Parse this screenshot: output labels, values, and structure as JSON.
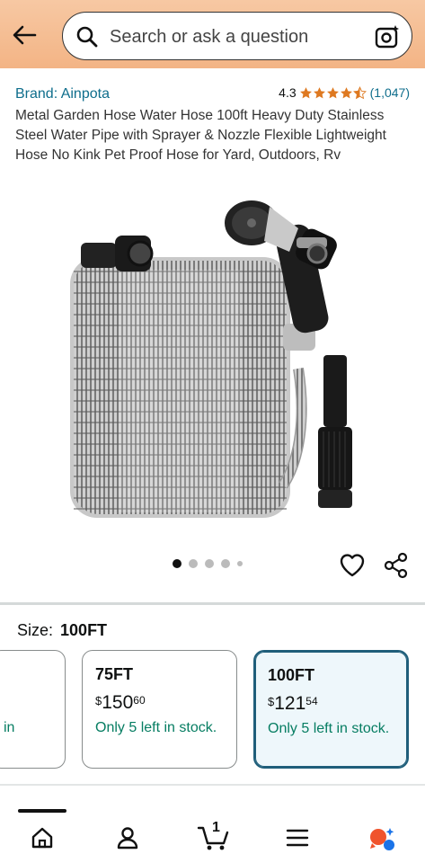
{
  "header": {
    "search_placeholder": "Search or ask a question"
  },
  "product": {
    "brand": "Brand: Ainpota",
    "rating": "4.3",
    "rating_stars": 4.3,
    "rating_count": "(1,047)",
    "title": "Metal Garden Hose Water Hose 100ft Heavy Duty Stainless Steel Water Pipe with Sprayer & Nozzle Flexible Lightweight Hose No Kink Pet Proof Hose for Yard, Outdoors, Rv",
    "image_count": 5,
    "active_image": 1
  },
  "size": {
    "label": "Size:",
    "selected": "100FT",
    "options": [
      {
        "name": "",
        "currency": "",
        "whole": "",
        "fraction": "",
        "stock": "in"
      },
      {
        "name": "75FT",
        "currency": "$",
        "whole": "150",
        "fraction": "60",
        "stock": "Only 5 left in stock."
      },
      {
        "name": "100FT",
        "currency": "$",
        "whole": "121",
        "fraction": "54",
        "stock": "Only 5 left in stock."
      }
    ]
  },
  "nav": {
    "cart_count": "1"
  },
  "colors": {
    "header_bg": "#f3b485",
    "link": "#0f6e8c",
    "star": "#de7921",
    "stock_green": "#067d62",
    "selected_border": "#1f5e7a"
  }
}
